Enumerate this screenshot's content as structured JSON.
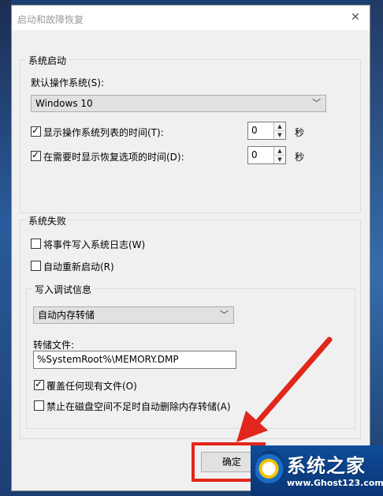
{
  "window": {
    "title": "启动和故障恢复"
  },
  "system_startup": {
    "legend": "系统启动",
    "default_os_label": "默认操作系统(S):",
    "default_os_value": "Windows 10",
    "show_os_list": {
      "label": "显示操作系统列表的时间(T):",
      "checked": true,
      "value": "0",
      "unit": "秒"
    },
    "show_recovery": {
      "label": "在需要时显示恢复选项的时间(D):",
      "checked": true,
      "value": "0",
      "unit": "秒"
    }
  },
  "system_failure": {
    "legend": "系统失败",
    "write_event": {
      "label": "将事件写入系统日志(W)",
      "checked": false
    },
    "auto_restart": {
      "label": "自动重新启动(R)",
      "checked": false
    },
    "debug_info": {
      "legend": "写入调试信息",
      "dump_type": "自动内存转储",
      "dump_file_label": "转储文件:",
      "dump_file_value": "%SystemRoot%\\MEMORY.DMP",
      "overwrite": {
        "label": "覆盖任何现有文件(O)",
        "checked": true
      },
      "disable_auto_delete": {
        "label": "禁止在磁盘空间不足时自动删除内存转储(A)",
        "checked": false
      }
    }
  },
  "buttons": {
    "ok": "确定"
  },
  "watermark": {
    "brand": "系统之家",
    "url": "www.Ghost123.com"
  },
  "annotation": {
    "highlight_color": "#e1261c"
  }
}
